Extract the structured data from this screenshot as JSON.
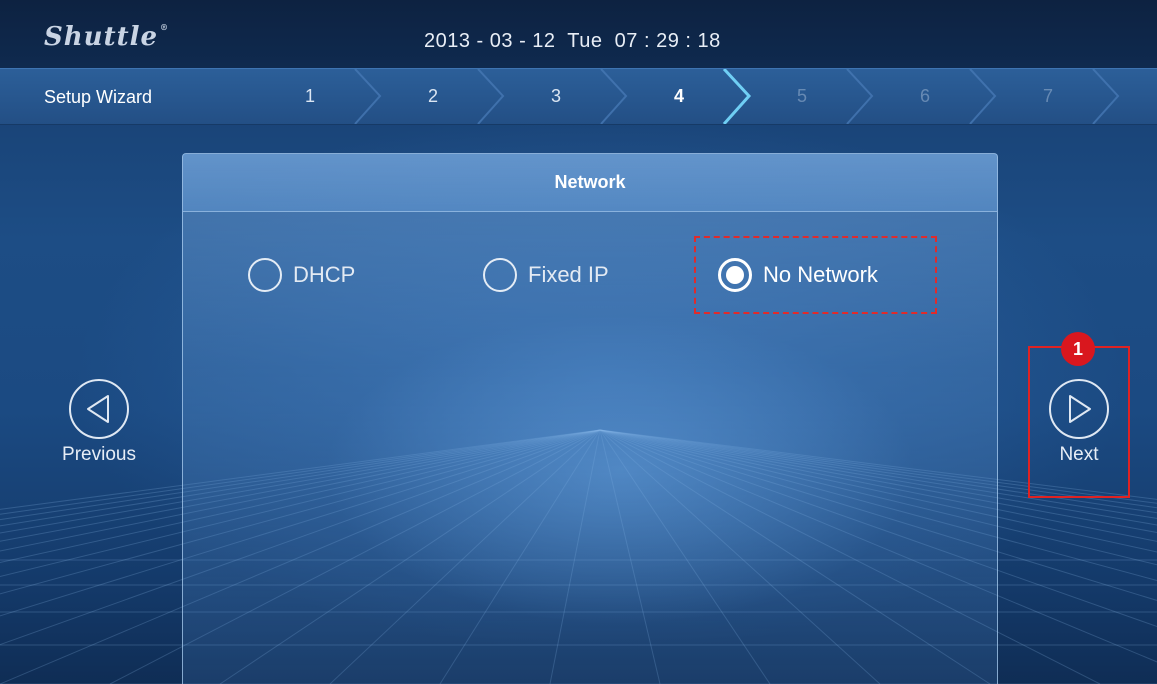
{
  "header": {
    "brand": "Shuttle",
    "brand_mark": "®",
    "date": "2013 - 03 - 12",
    "weekday": "Tue",
    "time": "07 : 29 : 18"
  },
  "wizard": {
    "title": "Setup Wizard",
    "current_step": 4,
    "steps": [
      {
        "label": "1",
        "state": "done"
      },
      {
        "label": "2",
        "state": "done"
      },
      {
        "label": "3",
        "state": "done"
      },
      {
        "label": "4",
        "state": "current"
      },
      {
        "label": "5",
        "state": "future"
      },
      {
        "label": "6",
        "state": "future"
      },
      {
        "label": "7",
        "state": "future"
      }
    ]
  },
  "panel": {
    "title": "Network",
    "options": [
      {
        "label": "DHCP",
        "selected": false
      },
      {
        "label": "Fixed IP",
        "selected": false
      },
      {
        "label": "No Network",
        "selected": true
      }
    ]
  },
  "nav": {
    "previous_label": "Previous",
    "next_label": "Next"
  },
  "annotations": {
    "callout_number": "1",
    "highlight_color": "#e02222"
  },
  "colors": {
    "background": "#1b4a82",
    "topbar": "#0d2241",
    "wizard_bar": "#2c5f99"
  }
}
